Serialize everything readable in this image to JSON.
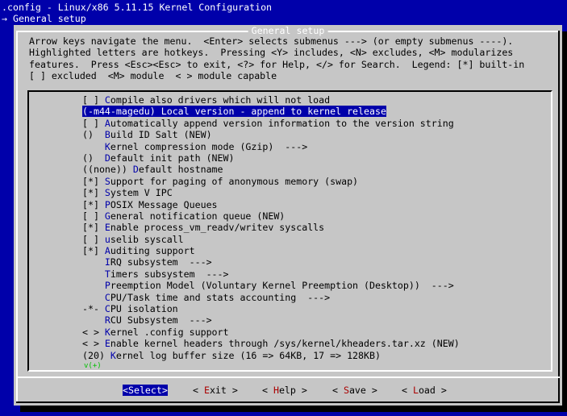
{
  "header": {
    "title": ".config - Linux/x86 5.11.15 Kernel Configuration",
    "breadcrumb": "→ General setup"
  },
  "dialog": {
    "title": "General setup",
    "help": [
      "Arrow keys navigate the menu.  <Enter> selects submenus ---> (or empty submenus ----).",
      "Highlighted letters are hotkeys.  Pressing <Y> includes, <N> excludes, <M> modularizes",
      "features.  Press <Esc><Esc> to exit, <?> for Help, </> for Search.  Legend: [*] built-in",
      "[ ] excluded  <M> module  < > module capable"
    ]
  },
  "menu": {
    "items": [
      {
        "prefix": "[ ] ",
        "hot": "C",
        "rest": "ompile also drivers which will not load",
        "selected": false
      },
      {
        "prefix": "(-m44-magedu) ",
        "hot": "L",
        "rest": "ocal version - append to kernel release",
        "selected": true
      },
      {
        "prefix": "[ ] ",
        "hot": "A",
        "rest": "utomatically append version information to the version string",
        "selected": false
      },
      {
        "prefix": "()  ",
        "hot": "B",
        "rest": "uild ID Salt (NEW)",
        "selected": false
      },
      {
        "prefix": "    ",
        "hot": "K",
        "rest": "ernel compression mode (Gzip)  --->",
        "selected": false
      },
      {
        "prefix": "()  ",
        "hot": "D",
        "rest": "efault init path (NEW)",
        "selected": false
      },
      {
        "prefix": "((none)) ",
        "hot": "D",
        "rest": "efault hostname",
        "selected": false
      },
      {
        "prefix": "[*] ",
        "hot": "S",
        "rest": "upport for paging of anonymous memory (swap)",
        "selected": false
      },
      {
        "prefix": "[*] ",
        "hot": "S",
        "rest": "ystem V IPC",
        "selected": false
      },
      {
        "prefix": "[*] ",
        "hot": "P",
        "rest": "OSIX Message Queues",
        "selected": false
      },
      {
        "prefix": "[ ] ",
        "hot": "G",
        "rest": "eneral notification queue (NEW)",
        "selected": false
      },
      {
        "prefix": "[*] ",
        "hot": "E",
        "rest": "nable process_vm_readv/writev syscalls",
        "selected": false
      },
      {
        "prefix": "[ ] ",
        "hot": "u",
        "rest": "selib syscall",
        "selected": false
      },
      {
        "prefix": "[*] ",
        "hot": "A",
        "rest": "uditing support",
        "selected": false
      },
      {
        "prefix": "    ",
        "hot": "I",
        "rest": "RQ subsystem  --->",
        "selected": false
      },
      {
        "prefix": "    ",
        "hot": "T",
        "rest": "imers subsystem  --->",
        "selected": false
      },
      {
        "prefix": "    ",
        "hot": "P",
        "rest": "reemption Model (Voluntary Kernel Preemption (Desktop))  --->",
        "selected": false
      },
      {
        "prefix": "    ",
        "hot": "C",
        "rest": "PU/Task time and stats accounting  --->",
        "selected": false
      },
      {
        "prefix": "-*- ",
        "hot": "C",
        "rest": "PU isolation",
        "selected": false
      },
      {
        "prefix": "    ",
        "hot": "R",
        "rest": "CU Subsystem  --->",
        "selected": false
      },
      {
        "prefix": "< > ",
        "hot": "K",
        "rest": "ernel .config support",
        "selected": false
      },
      {
        "prefix": "< > ",
        "hot": "E",
        "rest": "nable kernel headers through /sys/kernel/kheaders.tar.xz (NEW)",
        "selected": false
      },
      {
        "prefix": "(20) ",
        "hot": "K",
        "rest": "ernel log buffer size (16 => 64KB, 17 => 128KB)",
        "selected": false
      }
    ],
    "more_indicator": "v(+)"
  },
  "buttons": [
    {
      "open": "<",
      "hot": "S",
      "rest": "elect",
      "close": ">",
      "active": true
    },
    {
      "open": "< ",
      "hot": "E",
      "rest": "xit",
      "close": " >",
      "active": false
    },
    {
      "open": "< ",
      "hot": "H",
      "rest": "elp",
      "close": " >",
      "active": false
    },
    {
      "open": "< ",
      "hot": "S",
      "rest": "ave",
      "close": " >",
      "active": false
    },
    {
      "open": "< ",
      "hot": "L",
      "rest": "oad",
      "close": " >",
      "active": false
    }
  ],
  "colors": {
    "background": "#0000aa",
    "dialog": "#c6c6c6",
    "hotkey": "#0000aa",
    "button_hotkey": "#aa0000",
    "selection_bg": "#0000aa",
    "selection_fg": "#ffffff"
  }
}
